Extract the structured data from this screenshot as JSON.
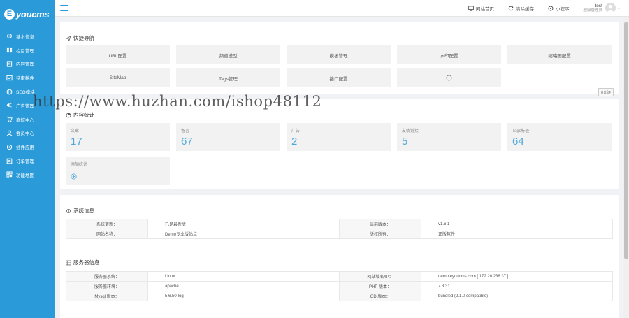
{
  "brand": {
    "logo_mark": "E",
    "logo_text": "youcms",
    "accent": "#2a9bd8",
    "stat_color": "#4fa8d9"
  },
  "sidebar": {
    "items": [
      {
        "label": "基本信息",
        "icon": "gear-icon"
      },
      {
        "label": "栏目管理",
        "icon": "grid-icon"
      },
      {
        "label": "内容管理",
        "icon": "document-icon"
      },
      {
        "label": "待审稿件",
        "icon": "audit-icon"
      },
      {
        "label": "SEO模块",
        "icon": "seo-icon"
      },
      {
        "label": "广告管理",
        "icon": "ad-icon"
      },
      {
        "label": "商城中心",
        "icon": "cart-icon"
      },
      {
        "label": "会员中心",
        "icon": "user-icon"
      },
      {
        "label": "插件应用",
        "icon": "plugin-icon"
      },
      {
        "label": "订单管理",
        "icon": "order-icon"
      },
      {
        "label": "功能地图",
        "icon": "map-icon"
      }
    ]
  },
  "topbar": {
    "links": [
      {
        "label": "网站首页",
        "icon": "monitor-icon"
      },
      {
        "label": "清除缓存",
        "icon": "refresh-icon"
      },
      {
        "label": "小程序",
        "icon": "miniapp-icon"
      }
    ],
    "user": {
      "name": "test",
      "role": "超级管理员"
    }
  },
  "quick_nav": {
    "title": "快捷导航",
    "tiles": [
      "URL配置",
      "频道模型",
      "模板管理",
      "水印配置",
      "缩略图配置",
      "SiteMap",
      "Tags管理",
      "接口配置"
    ],
    "add_icon": "plus-circle-icon",
    "badge": "0允许"
  },
  "content_stats": {
    "title": "内容统计",
    "items": [
      {
        "label": "文章",
        "value": "17"
      },
      {
        "label": "留言",
        "value": "67"
      },
      {
        "label": "广告",
        "value": "2"
      },
      {
        "label": "友情链接",
        "value": "5"
      },
      {
        "label": "Tags标签",
        "value": "64"
      }
    ],
    "add_label": "添加统计"
  },
  "system_info": {
    "title": "系统信息",
    "rows": [
      [
        "系统更新：",
        "已是最新版",
        "当前版本：",
        "v1.6.1"
      ],
      [
        "网站名称：",
        "Demo专业版站点",
        "版权所有：",
        "正版软件"
      ]
    ]
  },
  "server_info": {
    "title": "服务器信息",
    "rows": [
      [
        "服务器系统：",
        "Linux",
        "网站域名/IP：",
        "demo.eyoucms.com [ 172.20.238.37 ]"
      ],
      [
        "服务器环境：",
        "apache",
        "PHP 版本：",
        "7.3.31"
      ],
      [
        "Mysql 版本：",
        "5.6.50-log",
        "GD 版本：",
        "bundled (2.1.0 compatible)"
      ]
    ]
  },
  "watermark": "https://www.huzhan.com/ishop48112"
}
